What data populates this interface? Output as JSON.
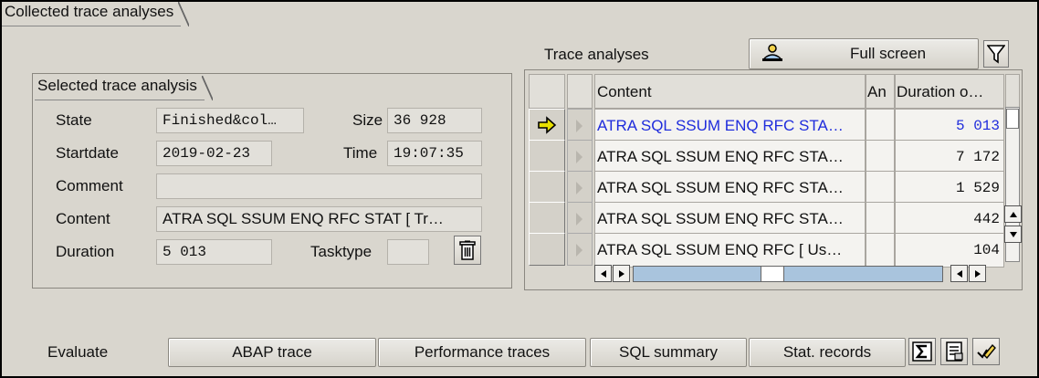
{
  "frame": {
    "title": "Collected trace analyses"
  },
  "selected": {
    "title": "Selected trace analysis",
    "state_label": "State",
    "state_value": "Finished&col…",
    "size_label": "Size",
    "size_value": "36 928",
    "startdate_label": "Startdate",
    "startdate_value": "2019-02-23",
    "time_label": "Time",
    "time_value": "19:07:35",
    "comment_label": "Comment",
    "comment_value": "",
    "content_label": "Content",
    "content_value": "ATRA SQL SSUM ENQ RFC STAT [ Tr…",
    "duration_label": "Duration",
    "duration_value": "5 013",
    "tasktype_label": "Tasktype",
    "tasktype_value": "",
    "delete_icon": "trash-icon"
  },
  "trace": {
    "title": "Trace analyses",
    "fullscreen_label": "Full screen",
    "fullscreen_icon": "person-screen-icon",
    "filter_icon": "filter-icon",
    "columns": {
      "content": "Content",
      "an": "An",
      "duration": "Duration o…"
    },
    "rows": [
      {
        "content": "ATRA SQL SSUM ENQ RFC STA…",
        "duration": "5 013",
        "selected": true
      },
      {
        "content": "ATRA SQL SSUM ENQ RFC STA…",
        "duration": "7 172"
      },
      {
        "content": "ATRA SQL SSUM ENQ RFC STA…",
        "duration": "1 529"
      },
      {
        "content": "ATRA SQL SSUM ENQ RFC STA…",
        "duration": "442"
      },
      {
        "content": "ATRA SQL SSUM ENQ RFC [ Us…",
        "duration": "104"
      }
    ]
  },
  "evaluate": {
    "label": "Evaluate",
    "buttons": [
      "ABAP trace",
      "Performance traces",
      "SQL summary",
      "Stat. records"
    ],
    "icons": [
      "sigma-icon",
      "report-icon",
      "edit-check-icon"
    ]
  },
  "colors": {
    "background": "#d9d6ce",
    "selected_text": "#1f2cdc",
    "current_row_arrow": "#e8e000"
  }
}
